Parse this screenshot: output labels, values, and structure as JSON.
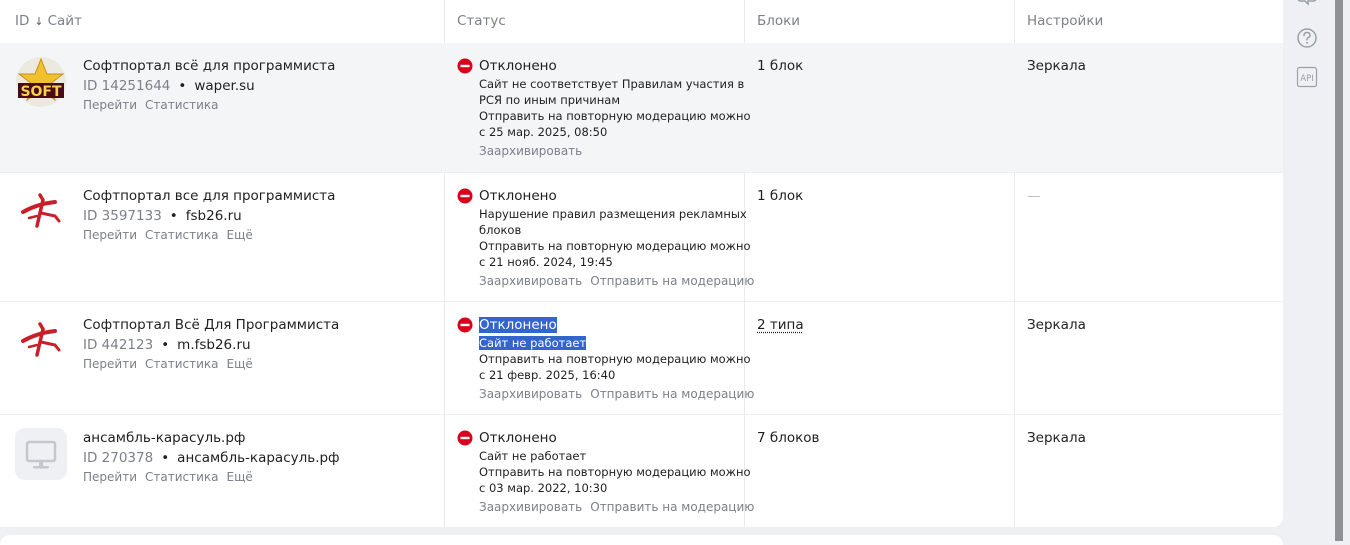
{
  "header": {
    "col_site_id": "ID",
    "col_site_sort": "↓",
    "col_site_name": "Сайт",
    "col_status": "Статус",
    "col_blocks": "Блоки",
    "col_settings": "Настройки"
  },
  "rows": [
    {
      "logo": "softportal-star-logo",
      "name": "Софтпортал всё для программиста",
      "id": "ID 14251644",
      "domain": "waper.su",
      "links": [
        "Перейти",
        "Статистика"
      ],
      "status_title": "Отклонено",
      "status_lines": [
        "Сайт не соответствует Правилам участия в",
        "РСЯ по иным причинам",
        "Отправить на повторную модерацию можно",
        "с 25 мар. 2025, 08:50"
      ],
      "actions": [
        "Заархивировать"
      ],
      "blocks": "1 блок",
      "settings": "Зеркала"
    },
    {
      "logo": "fsb-runner-logo",
      "name": "Софтпортал все для программиста",
      "id": "ID 3597133",
      "domain": "fsb26.ru",
      "links": [
        "Перейти",
        "Статистика",
        "Ещё"
      ],
      "status_title": "Отклонено",
      "status_lines": [
        "Нарушение правил размещения рекламных",
        "блоков",
        "Отправить на повторную модерацию можно",
        "с 21 нояб. 2024, 19:45"
      ],
      "actions": [
        "Заархивировать",
        "Отправить на модерацию"
      ],
      "blocks": "1 блок",
      "settings": "—"
    },
    {
      "logo": "fsb-runner-logo",
      "name": "Софтпортал Всё Для Программиста",
      "id": "ID 442123",
      "domain": "m.fsb26.ru",
      "links": [
        "Перейти",
        "Статистика",
        "Ещё"
      ],
      "status_title": "Отклонено",
      "status_lines": [
        "Сайт не работает",
        "Отправить на повторную модерацию можно",
        "с 21 февр. 2025, 16:40"
      ],
      "actions": [
        "Заархивировать",
        "Отправить на модерацию"
      ],
      "blocks": "2 типа",
      "settings": "Зеркала"
    },
    {
      "logo": "monitor-placeholder-icon",
      "name": "ансамбль-карасуль.рф",
      "id": "ID 270378",
      "domain": "ансамбль-карасуль.рф",
      "links": [
        "Перейти",
        "Статистика",
        "Ещё"
      ],
      "status_title": "Отклонено",
      "status_lines": [
        "Сайт не работает",
        "Отправить на повторную модерацию можно",
        "с 03 мар. 2022, 10:30"
      ],
      "actions": [
        "Заархивировать",
        "Отправить на модерацию"
      ],
      "blocks": "7 блоков",
      "settings": "Зеркала"
    }
  ],
  "sidebar": {
    "icons": [
      "chat-icon",
      "help-icon",
      "api-icon"
    ],
    "api_label": "API"
  },
  "colors": {
    "stop_red": "#d9001b",
    "selection_blue": "#3366cc",
    "muted_text": "#7c8089",
    "row_shade": "#f4f5f7",
    "page_bg": "#eef0f4"
  }
}
